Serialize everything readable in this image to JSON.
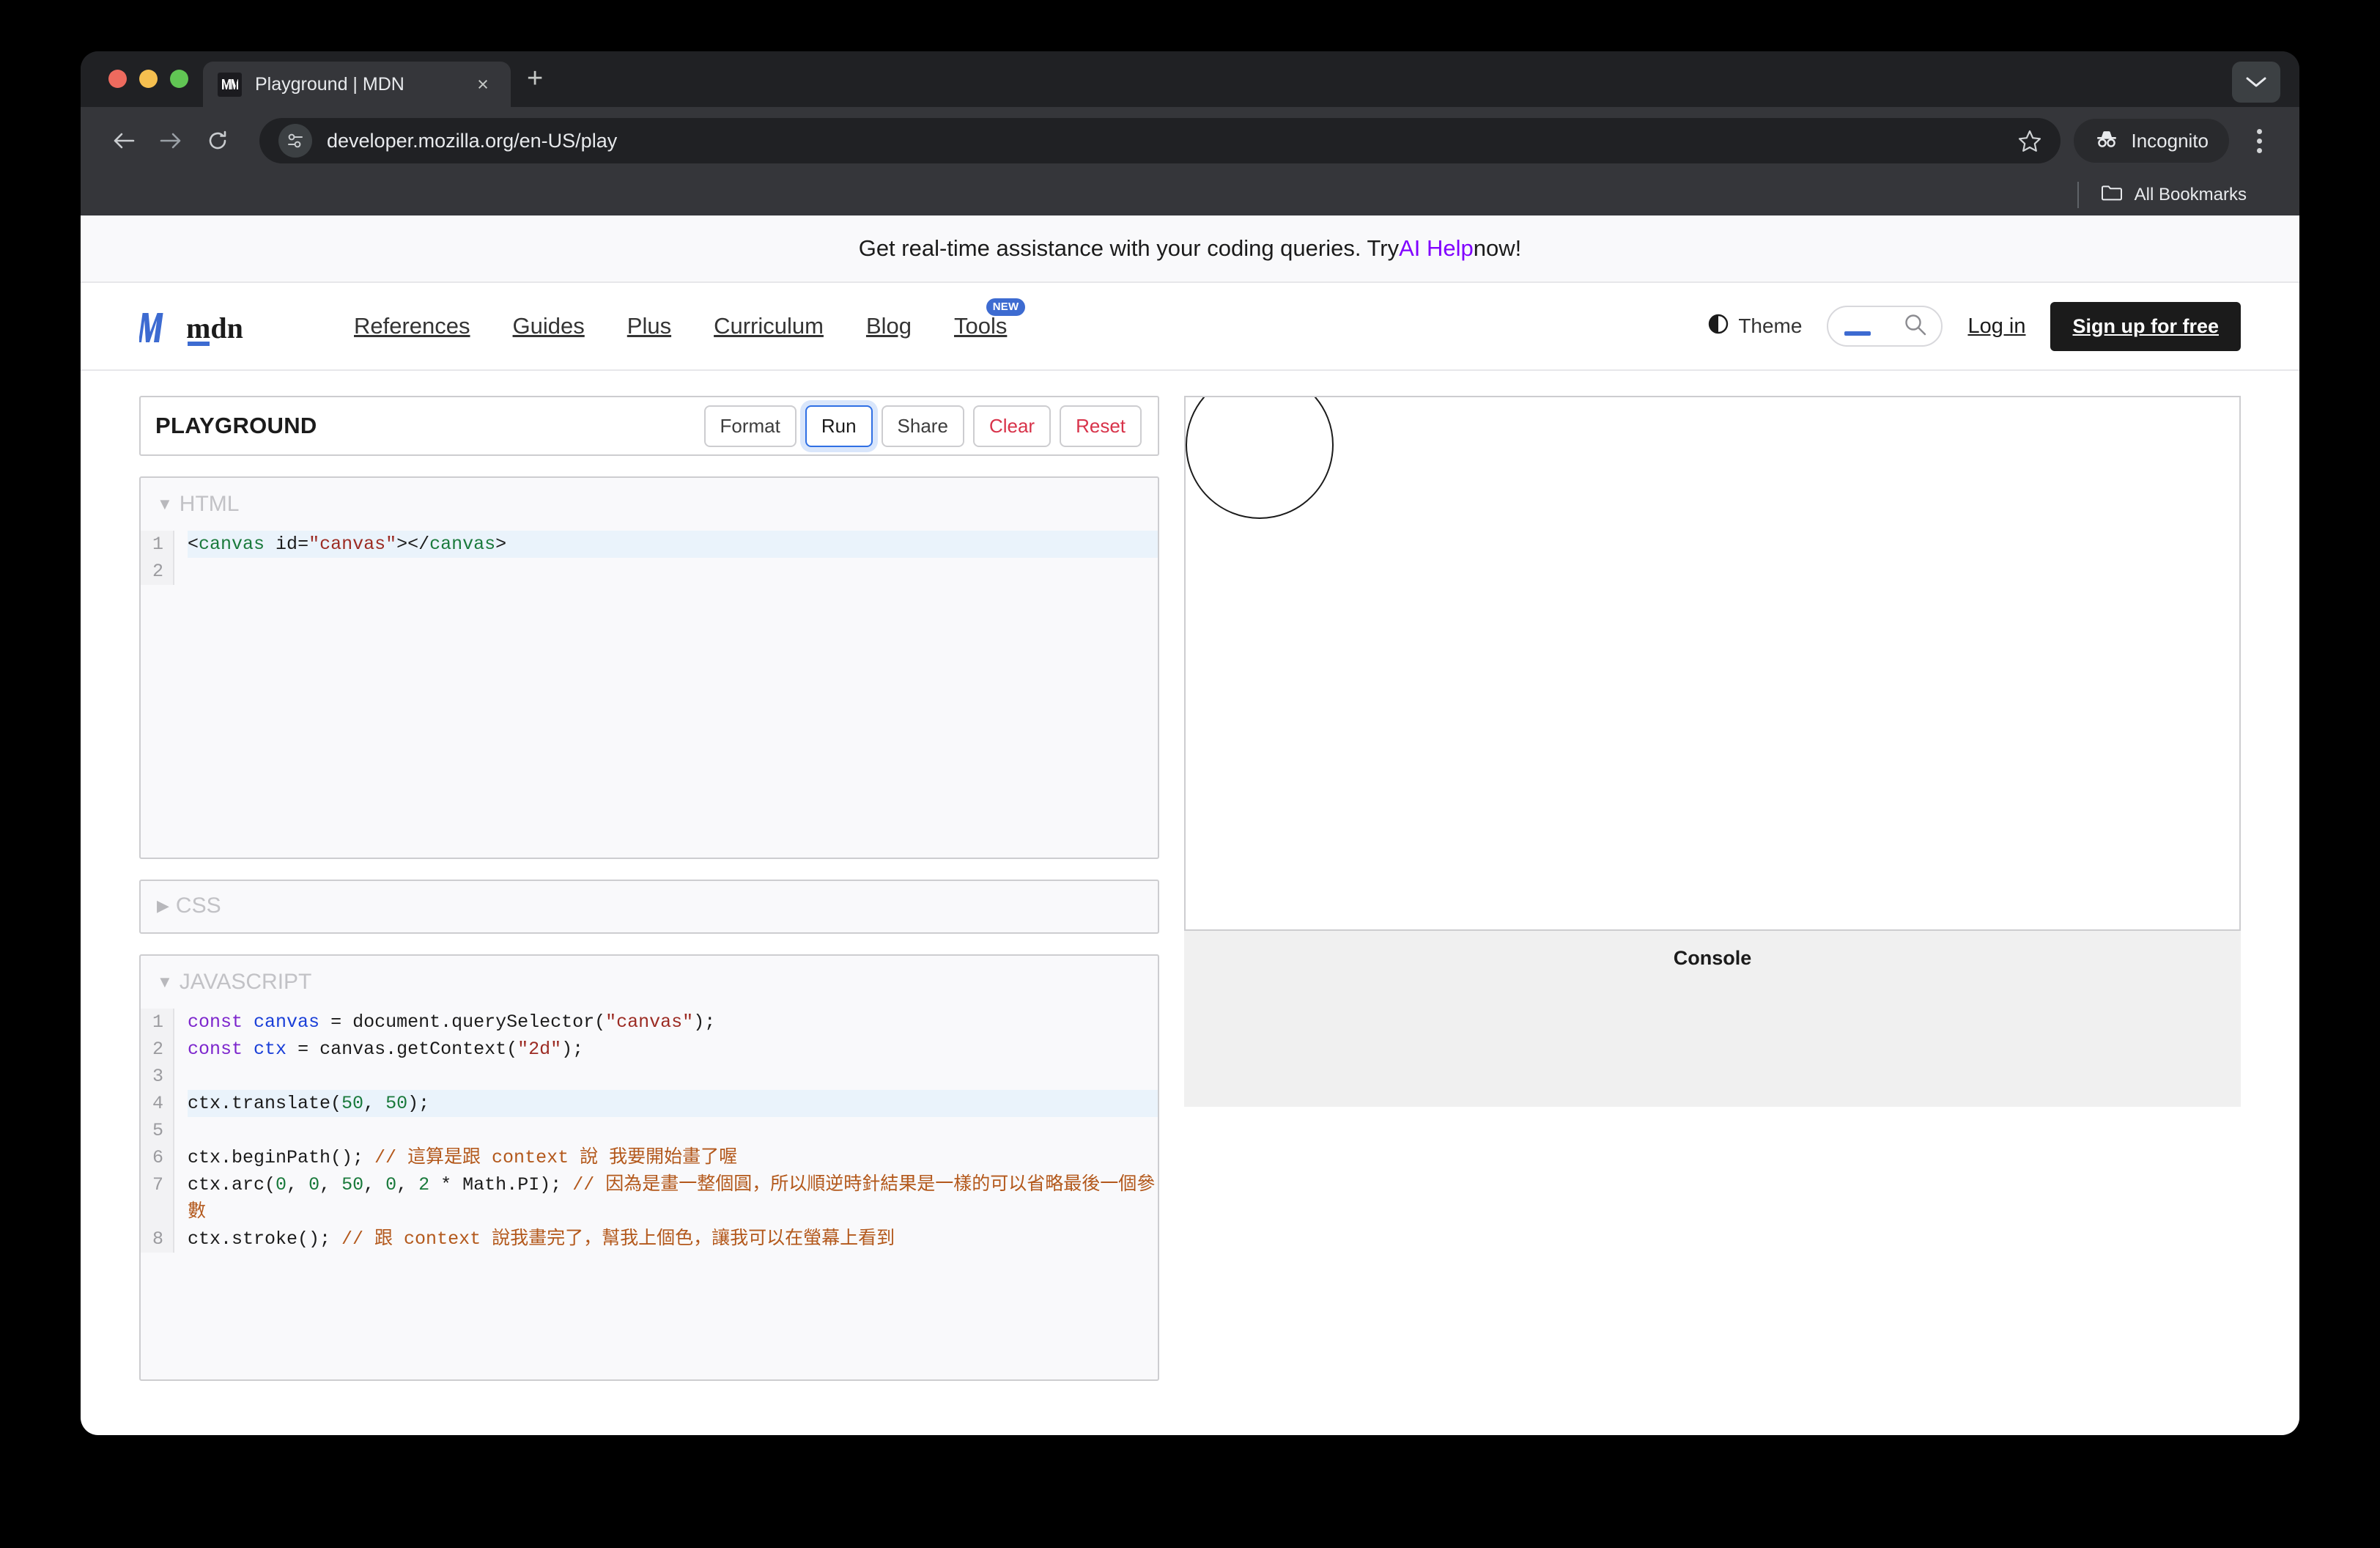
{
  "browser": {
    "tab": {
      "title": "Playground | MDN",
      "favicon": "mdn-favicon",
      "close": "×"
    },
    "new_tab_label": "+",
    "url": "developer.mozilla.org/en-US/play",
    "profile_label": "Incognito",
    "bookmarks_label": "All Bookmarks"
  },
  "banner": {
    "text_before": "Get real-time assistance with your coding queries. Try ",
    "link": "AI Help",
    "text_after": " now!"
  },
  "nav": {
    "logo": "mdn",
    "links": [
      {
        "label": "References",
        "badge": ""
      },
      {
        "label": "Guides",
        "badge": ""
      },
      {
        "label": "Plus",
        "badge": ""
      },
      {
        "label": "Curriculum",
        "badge": ""
      },
      {
        "label": "Blog",
        "badge": ""
      },
      {
        "label": "Tools",
        "badge": "NEW"
      }
    ],
    "theme_label": "Theme",
    "search_placeholder": "",
    "login_label": "Log in",
    "signup_label": "Sign up for free"
  },
  "playground": {
    "title": "PLAYGROUND",
    "buttons": [
      {
        "label": "Format",
        "style": "normal"
      },
      {
        "label": "Run",
        "style": "focused"
      },
      {
        "label": "Share",
        "style": "normal"
      },
      {
        "label": "Clear",
        "style": "danger"
      },
      {
        "label": "Reset",
        "style": "danger"
      }
    ],
    "panels": [
      {
        "label": "HTML",
        "expanded": true,
        "marker": "▼"
      },
      {
        "label": "CSS",
        "expanded": false,
        "marker": "▶"
      },
      {
        "label": "JAVASCRIPT",
        "expanded": true,
        "marker": "▼"
      }
    ],
    "html_code": {
      "line_numbers": [
        "1",
        "2"
      ],
      "highlighted_line": 1,
      "text": "<canvas id=\"canvas\"></canvas>"
    },
    "js_code": {
      "line_numbers": [
        "1",
        "2",
        "3",
        "4",
        "5",
        "6",
        "7",
        "8"
      ],
      "highlighted_line": 4,
      "lines": [
        "const canvas = document.querySelector(\"canvas\");",
        "const ctx = canvas.getContext(\"2d\");",
        "",
        "ctx.translate(50, 50);",
        "",
        "ctx.beginPath(); // 這算是跟 context 說 我要開始畫了喔",
        "ctx.arc(0, 0, 50, 0, 2 * Math.PI); // 因為是畫一整個圓，所以順逆時針結果是一樣的可以省略最後一個參數",
        "ctx.stroke(); // 跟 context 說我畫完了，幫我上個色，讓我可以在螢幕上看到"
      ]
    },
    "console_title": "Console",
    "output": {
      "shape": "circle-outline",
      "radius_px": 50,
      "translate": [
        50,
        50
      ]
    }
  },
  "colors": {
    "accent_blue": "#2f6fe4",
    "danger_red": "#d8334a",
    "ai_help_purple": "#8000ff",
    "badge_blue": "#3d6bd1",
    "signup_black": "#1b1b1b"
  }
}
